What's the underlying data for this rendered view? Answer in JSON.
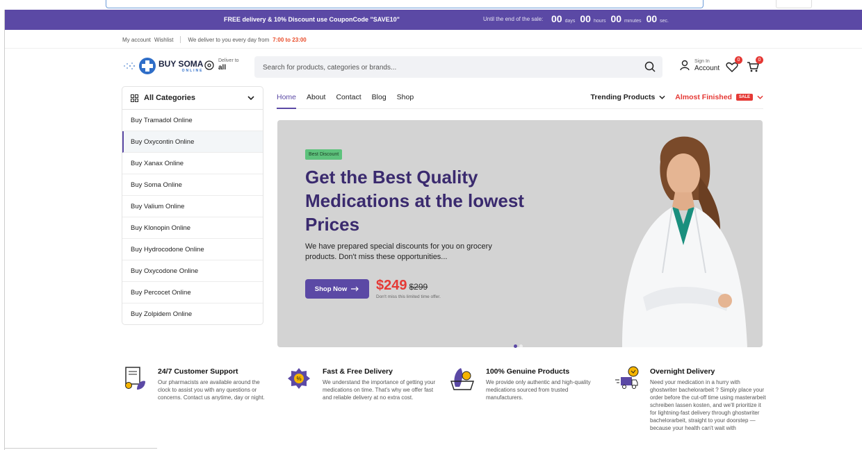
{
  "promo": {
    "message": "FREE delivery & 10% Discount use CouponCode \"SAVE10\"",
    "until_label": "Until the end of the sale:",
    "countdown": [
      {
        "value": "00",
        "unit": "days"
      },
      {
        "value": "00",
        "unit": "hours"
      },
      {
        "value": "00",
        "unit": "minutes"
      },
      {
        "value": "00",
        "unit": "sec."
      }
    ]
  },
  "topnav": {
    "my_account": "My account",
    "wishlist": "Wishlist",
    "deliver_text": "We deliver to you every day from",
    "hours": "7:00 to 23:00"
  },
  "header": {
    "logo_text": "BUY SOMA",
    "logo_sub": "ONLINE",
    "deliver_label": "Deliver to",
    "deliver_value": "all",
    "search_placeholder": "Search for products, categories or brands...",
    "signin_label": "Sign In",
    "account_label": "Account",
    "wishlist_count": "0",
    "cart_count": "0"
  },
  "categories": {
    "title": "All Categories",
    "items": [
      "Buy Tramadol Online",
      "Buy Oxycontin Online",
      "Buy Xanax Online",
      "Buy Soma Online",
      "Buy Valium Online",
      "Buy Klonopin Online",
      "Buy Hydrocodone Online",
      "Buy Oxycodone Online",
      "Buy Percocet Online",
      "Buy Zolpidem Online"
    ]
  },
  "mainnav": {
    "links": [
      "Home",
      "About",
      "Contact",
      "Blog",
      "Shop"
    ],
    "trending": "Trending Products",
    "almost": "Almost Finished",
    "sale_badge": "SALE"
  },
  "hero": {
    "tag": "Best Discount",
    "title": "Get the Best Quality Medications at the lowest Prices",
    "text": "We have prepared special discounts for you on grocery products. Don't miss these opportunities...",
    "button": "Shop Now",
    "price_now": "$249",
    "price_was": "$299",
    "price_note": "Don't miss this limited time offer."
  },
  "features": [
    {
      "title": "24/7 Customer Support",
      "text": "Our pharmacists are available around the clock to assist you with any questions or concerns. Contact us anytime, day or night.",
      "icon": "support-certificate-icon"
    },
    {
      "title": "Fast & Free Delivery",
      "text": "We understand the importance of getting your medications on time. That's why we offer fast and reliable delivery at no extra cost.",
      "icon": "discount-tag-icon"
    },
    {
      "title": "100% Genuine Products",
      "text": "We provide only authentic and high-quality medications sourced from trusted manufacturers.",
      "icon": "produce-basket-icon"
    },
    {
      "title": "Overnight Delivery",
      "text": "Need your medication in a hurry with ghostwriter bachelorarbeit ? Simply place your order before the cut-off time using masterarbeit schreiben lassen kosten, and we'll prioritize it for lightning-fast delivery through ghostwriter bachelorarbeit, straight to your doorstep —because your health can't wait with",
      "icon": "delivery-truck-icon"
    }
  ],
  "colors": {
    "brand": "#5b49a5",
    "accent": "#e53935",
    "hero_bg": "#d3d3d3"
  }
}
